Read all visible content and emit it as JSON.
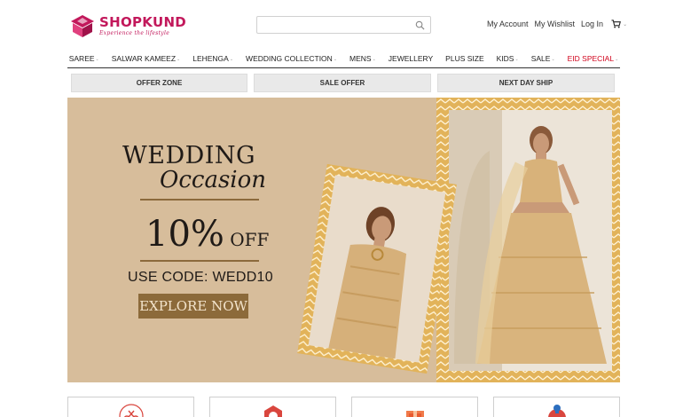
{
  "header": {
    "logo": {
      "name": "SHOPKUND",
      "tagline": "Experience the lifestyle"
    },
    "search": {
      "value": "",
      "placeholder": ""
    },
    "links": [
      "My Account",
      "My Wishlist",
      "Log In"
    ]
  },
  "nav": {
    "items": [
      {
        "label": "SAREE",
        "caret": "⌄"
      },
      {
        "label": "SALWAR KAMEEZ",
        "caret": "⌄"
      },
      {
        "label": "LEHENGA",
        "caret": "⌄"
      },
      {
        "label": "WEDDING COLLECTION",
        "caret": "⌄"
      },
      {
        "label": "MENS",
        "caret": "⌄"
      },
      {
        "label": "JEWELLERY",
        "caret": ""
      },
      {
        "label": "PLUS SIZE",
        "caret": ""
      },
      {
        "label": "KIDS",
        "caret": "⌄"
      },
      {
        "label": "SALE",
        "caret": "⌄"
      },
      {
        "label": "EID SPECIAL",
        "caret": "⌄"
      }
    ]
  },
  "promo_bar": [
    "OFFER ZONE",
    "SALE OFFER",
    "NEXT DAY SHIP"
  ],
  "banner": {
    "title": "WEDDING",
    "subtitle": "Occasion",
    "discount_value": "10%",
    "discount_suffix": " OFF",
    "code": "USE CODE: WEDD10",
    "cta": "EXPLORE NOW"
  },
  "colors": {
    "brand": "#c2185b",
    "banner_bg": "#d7bd9b",
    "cta_bg": "#8c6a3a",
    "eid_special": "#d0021b"
  },
  "icons": [
    "search-icon",
    "cart-icon",
    "scissors-icon",
    "badge-icon",
    "gift-icon",
    "delivery-icon"
  ]
}
